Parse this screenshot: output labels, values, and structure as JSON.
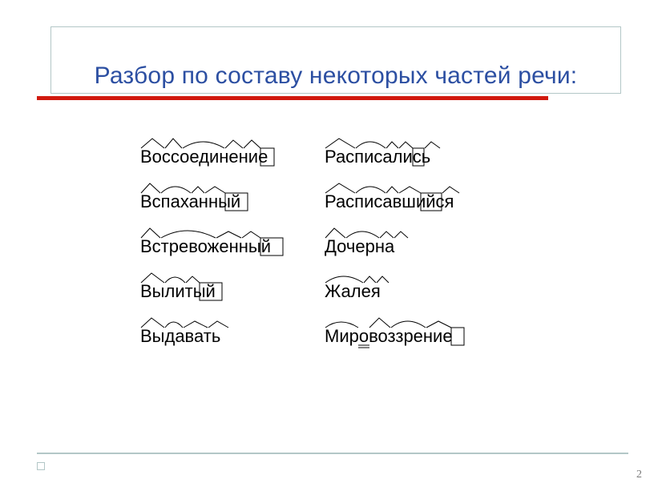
{
  "slide": {
    "title": "Разбор по составу некоторых частей речи:",
    "page_number": "2"
  },
  "words": {
    "col1": [
      "Воссоединение",
      "Вспаханный",
      "Встревоженный",
      "Вылитый",
      "Выдавать"
    ],
    "col2": [
      "Расписались",
      "Расписавшийся",
      "Дочерна",
      "Жалея",
      "Мировоззрение"
    ]
  }
}
